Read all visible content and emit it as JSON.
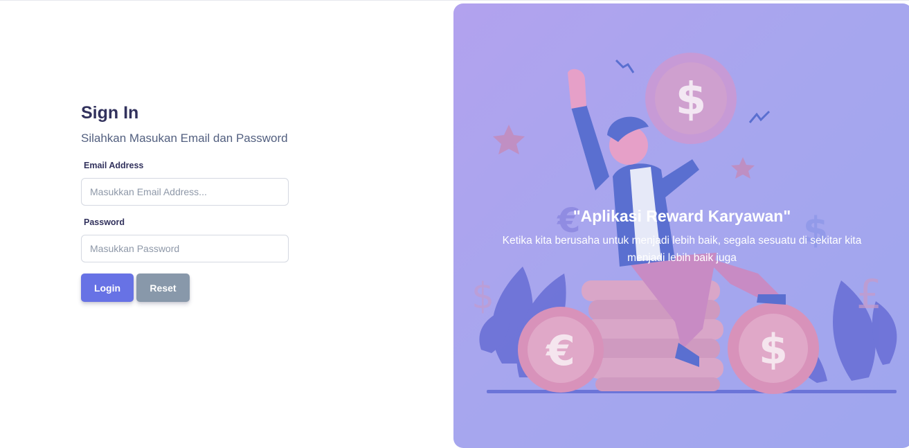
{
  "signin": {
    "title": "Sign In",
    "subtitle": "Silahkan Masukan Email dan Password",
    "email_label": "Email Address",
    "email_placeholder": "Masukkan Email Address...",
    "password_label": "Password",
    "password_placeholder": "Masukkan Password",
    "login_label": "Login",
    "reset_label": "Reset"
  },
  "hero": {
    "quote": "\"Aplikasi Reward Karyawan\"",
    "description": "Ketika kita berusaha untuk menjadi lebih baik, segala sesuatu di sekitar kita menjadi lebih baik juga"
  },
  "colors": {
    "primary": "#6772e5",
    "secondary": "#8898aa",
    "heading": "#32325d",
    "panel_gradient_start": "#b2a2ee",
    "panel_gradient_end": "#9fa6ee"
  }
}
